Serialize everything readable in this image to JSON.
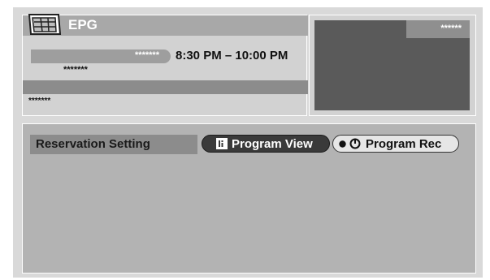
{
  "header": {
    "title": "EPG",
    "logo_icon": "epg-grid-icon"
  },
  "program": {
    "channel": "*******",
    "subtitle": "*******",
    "time_range": "8:30 PM – 10:00 PM",
    "description": "*******"
  },
  "preview": {
    "label": "******"
  },
  "reservation": {
    "label": "Reservation Setting",
    "buttons": {
      "program_view": "Program View",
      "program_rec": "Program Rec"
    }
  },
  "colors": {
    "panel": "#d2d2d2",
    "bar": "#a8a8a8",
    "preview": "#5a5a5a",
    "bottom": "#b3b3b3"
  }
}
